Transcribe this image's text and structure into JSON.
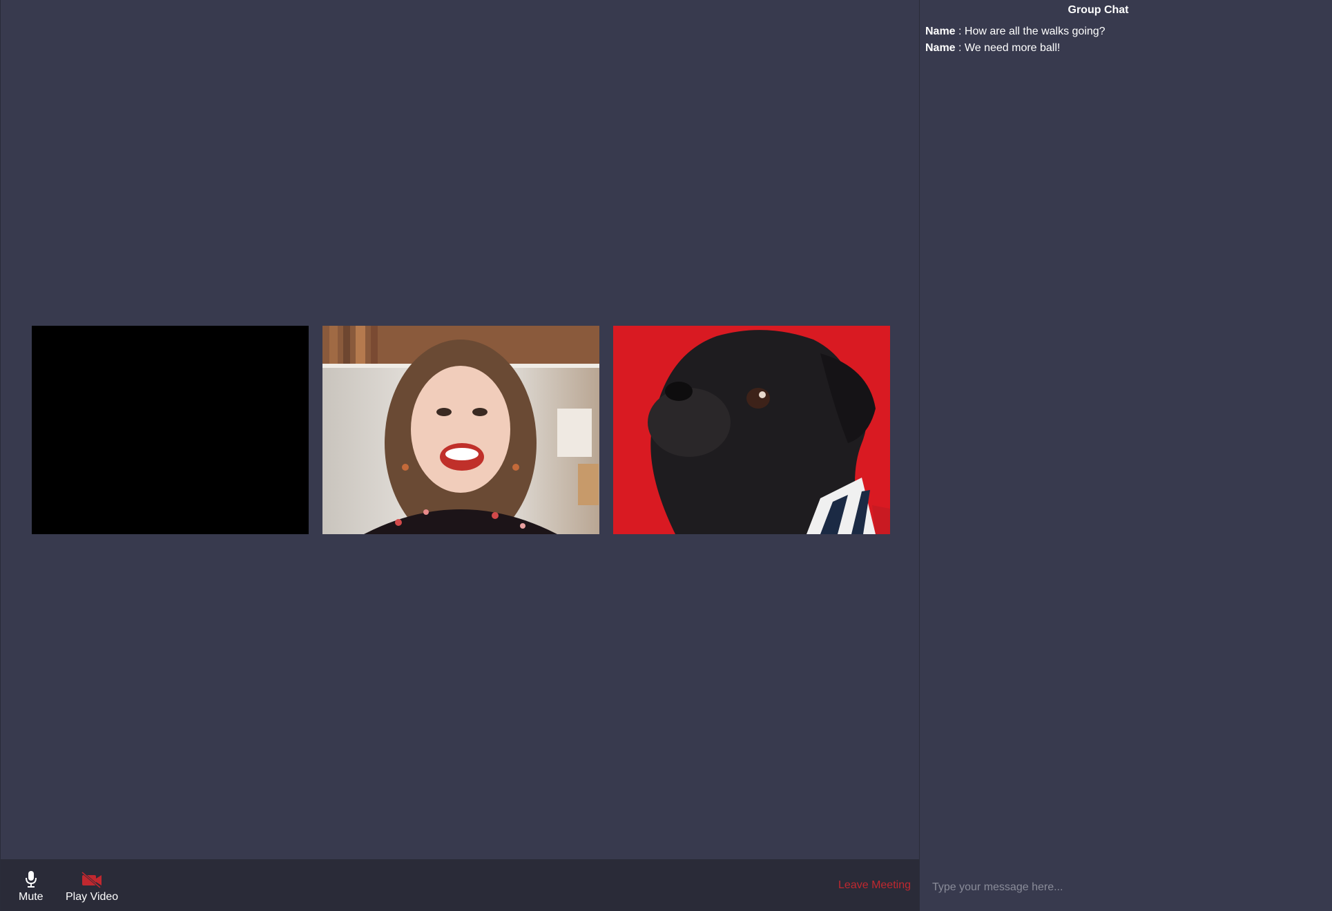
{
  "chat": {
    "title": "Group Chat",
    "messages": [
      {
        "name": "Name",
        "text": " : How are all the walks going?"
      },
      {
        "name": "Name",
        "text": " : We need more ball!"
      }
    ],
    "input_placeholder": "Type your message here..."
  },
  "controls": {
    "mute_label": "Mute",
    "mute_icon": "microphone-icon",
    "video_label": "Play Video",
    "video_icon": "video-camera-off-icon",
    "leave_label": "Leave Meeting"
  },
  "videos": [
    {
      "participant": "camera-off"
    },
    {
      "participant": "woman"
    },
    {
      "participant": "pug"
    }
  ],
  "colors": {
    "background": "#383a4e",
    "bottom_bar": "#2a2b38",
    "leave": "#c0282f",
    "video_off_icon": "#c0282f"
  }
}
